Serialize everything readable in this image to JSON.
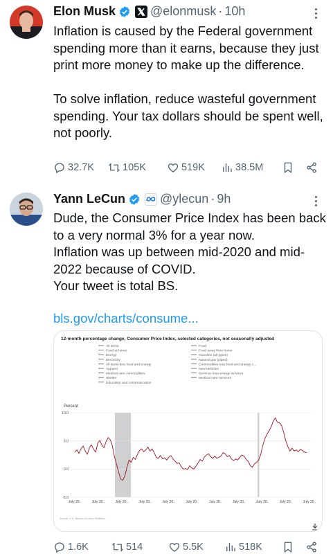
{
  "tweets": [
    {
      "author": "Elon Musk",
      "handle": "@elonmusk",
      "time": "10h",
      "text": "Inflation is caused by the Federal government spending more than it earns, because they just print more money to make up the difference.\n\nTo solve inflation, reduce wasteful government spending. Your tax dollars should be spent well, not poorly.",
      "stats": {
        "replies": "32.7K",
        "reposts": "105K",
        "likes": "519K",
        "views": "38.5M"
      }
    },
    {
      "author": "Yann LeCun",
      "handle": "@ylecun",
      "time": "9h",
      "text": "Dude, the Consumer Price Index has been back to a very normal 3% for a year now.\nInflation was up between mid-2020 and mid-2022 because of COVID.\nYour tweet is total BS.",
      "link": "bls.gov/charts/consume...",
      "stats": {
        "replies": "1.6K",
        "reposts": "514",
        "likes": "5.5K",
        "views": "518K"
      }
    }
  ],
  "colors": {
    "link": "#1d9bf0",
    "verified": "#1d9bf0",
    "muted": "#536471",
    "chart_line": "#a0121e",
    "recession_band": "#cfd0d2"
  },
  "icons": [
    "reply-icon",
    "repost-icon",
    "like-icon",
    "views-icon",
    "bookmark-icon",
    "share-icon",
    "verified-badge-icon",
    "x-logo-icon",
    "meta-logo-icon",
    "more-icon"
  ],
  "chart_data": {
    "type": "line",
    "title": "12-month percentage change, Consumer Price Index, selected categories, not seasonally adjusted",
    "ylabel": "Percent",
    "ylim": [
      -5,
      10
    ],
    "yticks": [
      "10.0",
      "5.0",
      "0.0",
      "-5.0"
    ],
    "x_ticks": [
      "July 20..",
      "July 20..",
      "July 20..",
      "July 20..",
      "July 20..",
      "July 20..",
      "July 20..",
      "July 20..",
      "July 20..",
      "July 20..",
      "July 20.."
    ],
    "legend_left": [
      "All items",
      "Food at home",
      "Energy",
      "Electricity",
      "All items less food and energy",
      "Apparel",
      "Medical care commodities",
      "Shelter",
      "Education and communication"
    ],
    "legend_right": [
      "Food",
      "Food away from home",
      "Gasoline (all types)",
      "Natural gas (piped)",
      "Commodities less food and energy c...",
      "New vehicles",
      "Services less energy services",
      "Medical care services"
    ],
    "source": "Source: U.S. Bureau of Labor Statistics.",
    "series": [
      {
        "name": "All items",
        "values": [
          3.0,
          3.4,
          2.8,
          3.6,
          4.1,
          3.2,
          2.6,
          3.8,
          4.3,
          3.5,
          3.0,
          4.6,
          5.1,
          4.2,
          3.8,
          4.9,
          5.6,
          5.2,
          4.1,
          2.2,
          0.8,
          -0.6,
          -1.8,
          -2.0,
          -1.2,
          0.4,
          1.6,
          1.2,
          2.1,
          1.7,
          2.6,
          3.3,
          3.6,
          3.1,
          3.4,
          3.9,
          3.2,
          3.6,
          2.9,
          2.1,
          1.9,
          2.4,
          1.8,
          2.0,
          1.6,
          2.1,
          2.4,
          1.8,
          1.4,
          1.0,
          1.1,
          0.4,
          0.0,
          0.1,
          -0.1,
          0.6,
          0.2,
          0.0,
          0.5,
          1.1,
          1.7,
          1.4,
          2.1,
          2.5,
          2.7,
          2.2,
          1.9,
          2.3,
          1.9,
          2.1,
          2.3,
          2.9,
          2.7,
          2.2,
          2.4,
          1.8,
          1.5,
          1.8,
          1.6,
          2.1,
          2.5,
          2.3,
          1.7,
          1.4,
          0.6,
          0.3,
          0.9,
          1.2,
          1.6,
          2.6,
          4.2,
          5.4,
          6.2,
          6.8,
          7.5,
          8.5,
          9.1,
          8.3,
          8.2,
          7.7,
          6.5,
          5.0,
          4.0,
          3.2,
          3.7,
          3.2,
          3.4,
          3.1,
          3.5,
          3.3,
          3.0,
          2.9
        ]
      }
    ],
    "recession_bands": [
      "late-2007 to mid-2009",
      "early-2020 to spring-2020"
    ]
  }
}
